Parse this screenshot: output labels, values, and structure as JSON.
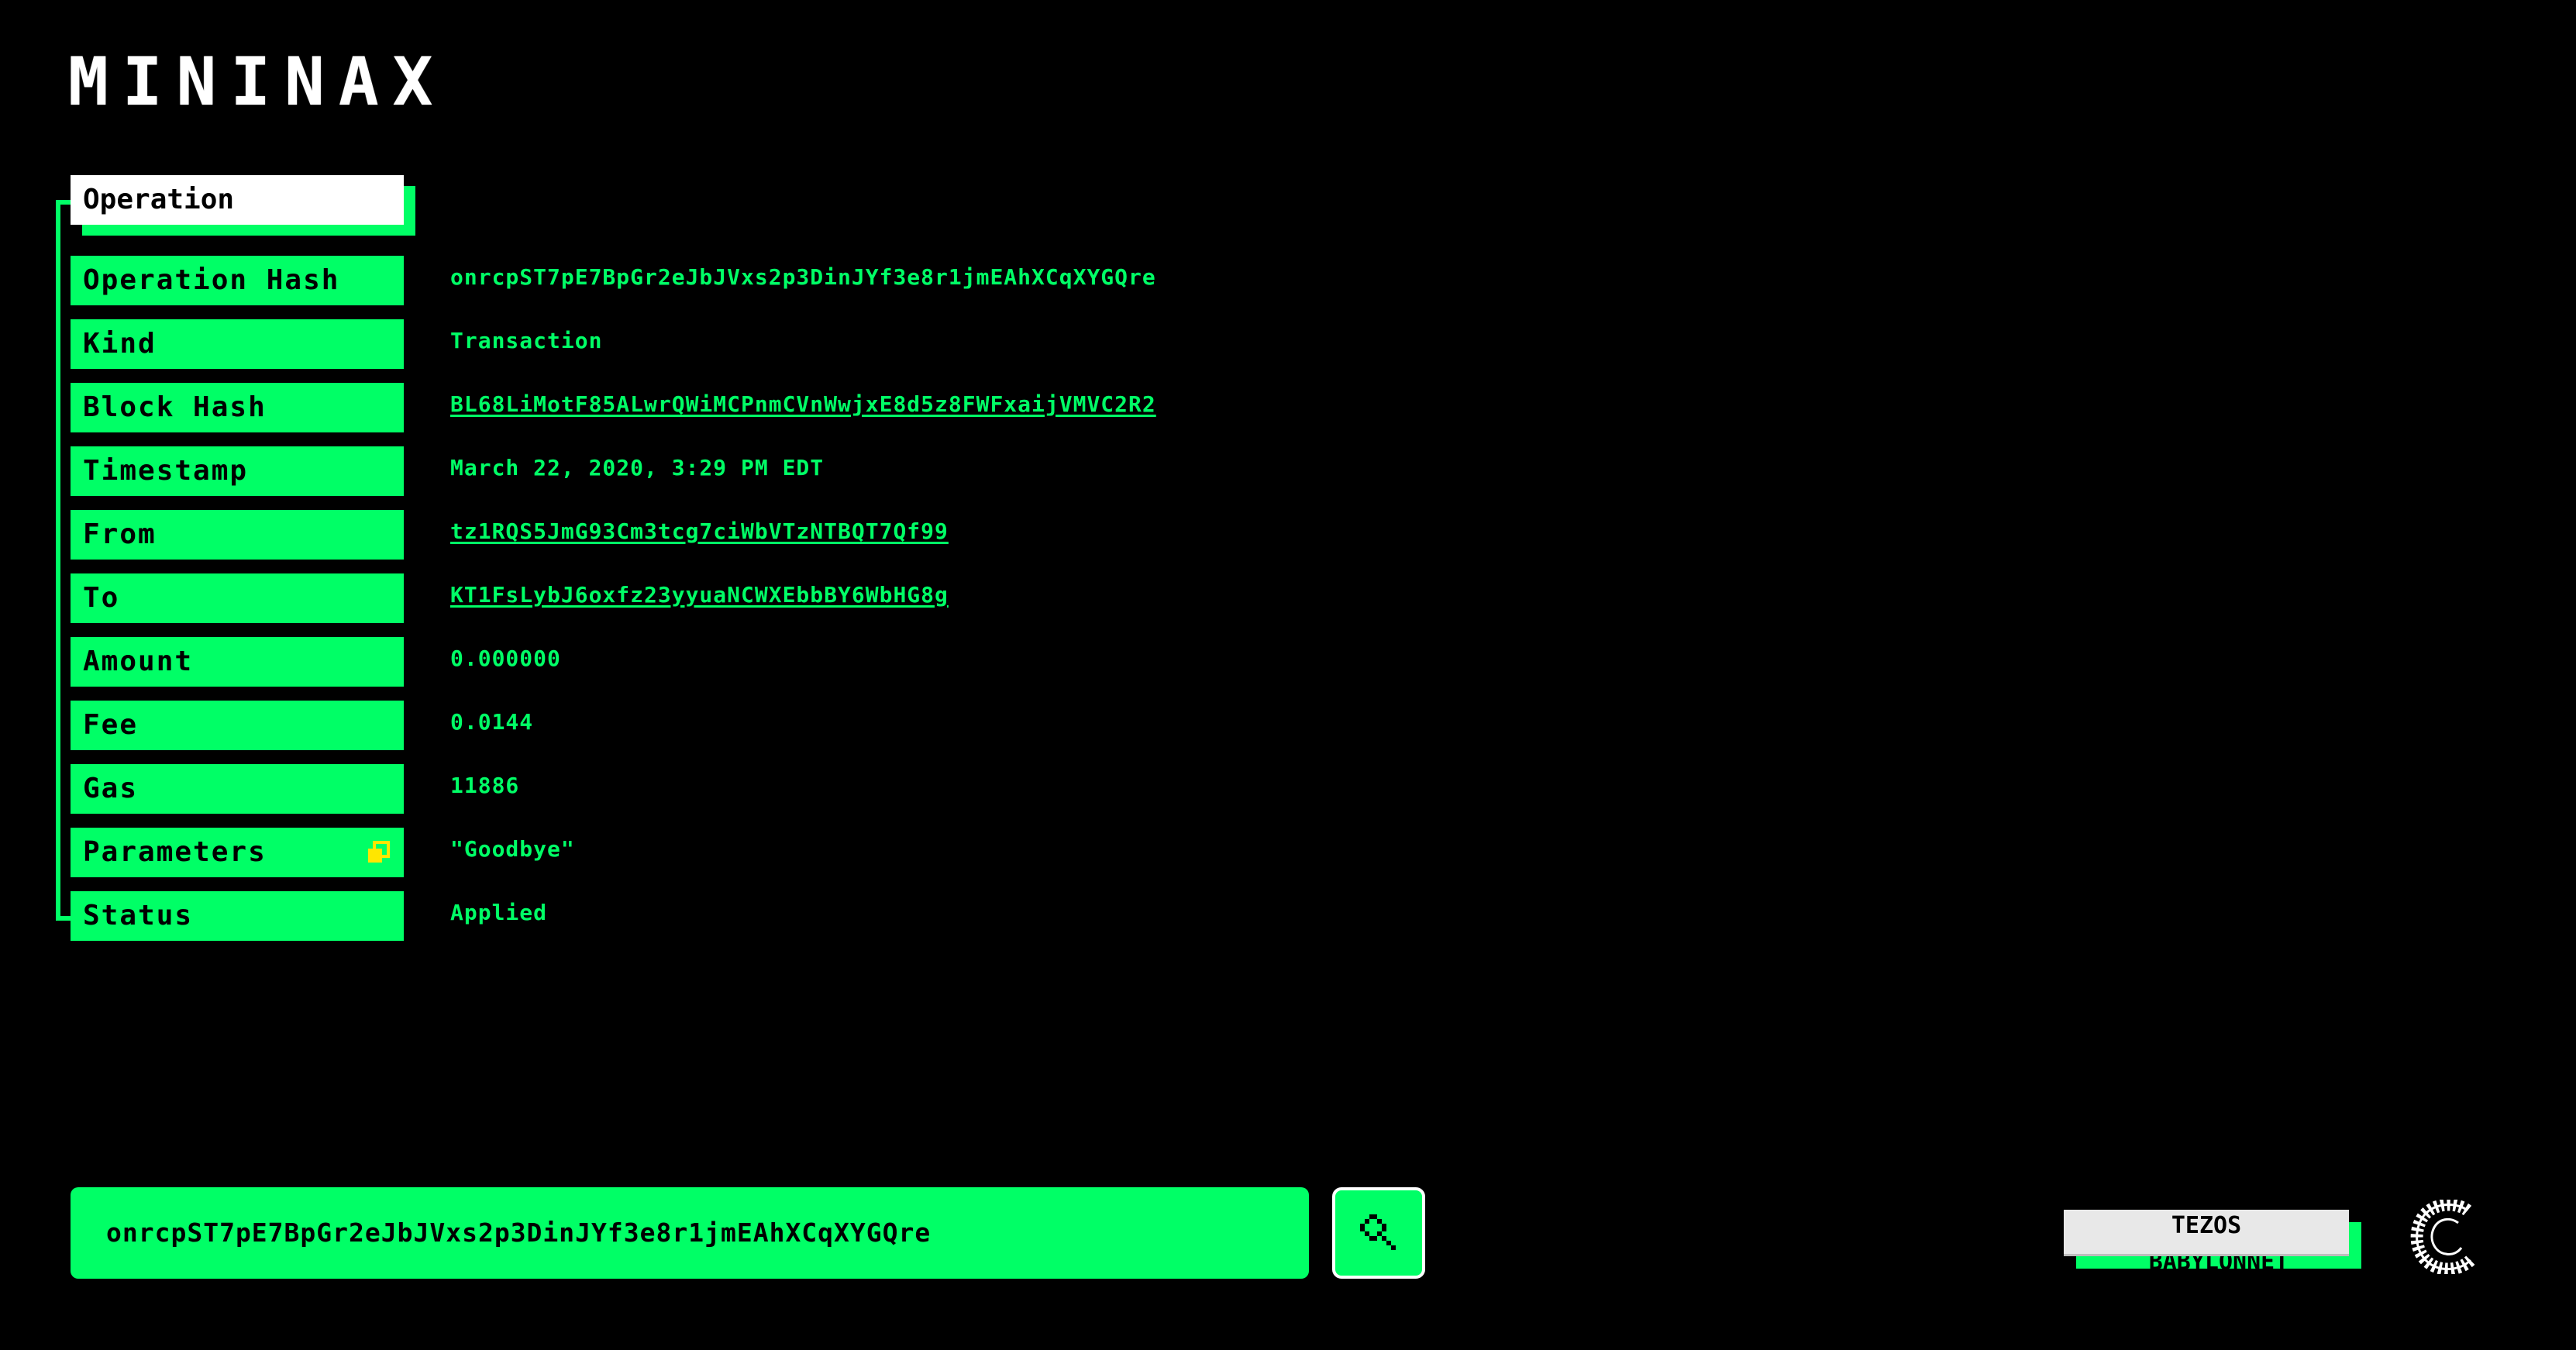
{
  "app": {
    "logo": "MININAX"
  },
  "section": {
    "title": "Operation"
  },
  "rows": [
    {
      "label": "Operation Hash",
      "value": "onrcpST7pE7BpGr2eJbJVxs2p3DinJYf3e8r1jmEAhXCqXYGQre",
      "link": false
    },
    {
      "label": "Kind",
      "value": "Transaction",
      "link": false
    },
    {
      "label": "Block Hash",
      "value": "BL68LiMotF85ALwrQWiMCPnmCVnWwjxE8d5z8FWFxaijVMVC2R2",
      "link": true
    },
    {
      "label": "Timestamp",
      "value": "March 22, 2020, 3:29 PM EDT",
      "link": false
    },
    {
      "label": "From",
      "value": "tz1RQS5JmG93Cm3tcg7ciWbVTzNTBQT7Qf99",
      "link": true
    },
    {
      "label": "To",
      "value": "KT1FsLybJ6oxfz23yyuaNCWXEbbBY6WbHG8g",
      "link": true
    },
    {
      "label": "Amount",
      "value": "0.000000",
      "link": false
    },
    {
      "label": "Fee",
      "value": "0.0144",
      "link": false
    },
    {
      "label": "Gas",
      "value": "11886",
      "link": false
    },
    {
      "label": "Parameters",
      "value": "\"Goodbye\"",
      "link": false
    },
    {
      "label": "Status",
      "value": "Applied",
      "link": false
    }
  ],
  "search": {
    "value": "onrcpST7pE7BpGr2eJbJVxs2p3DinJYf3e8r1jmEAhXCqXYGQre",
    "icon": "search-icon"
  },
  "network": {
    "name": "TEZOS",
    "chain": "BABYLONNET"
  },
  "icons": {
    "copy": "copy-icon",
    "brand": "brand-logo-icon"
  },
  "colors": {
    "background": "#000000",
    "accent": "#00ff66",
    "header": "#ffffff",
    "copy_icon": "#ffe600"
  }
}
